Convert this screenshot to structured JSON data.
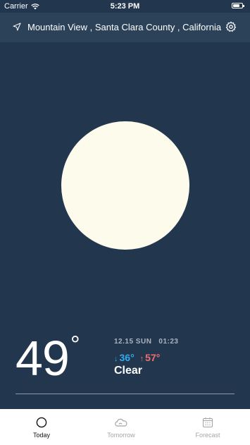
{
  "status_bar": {
    "carrier": "Carrier",
    "time": "5:23 PM"
  },
  "header": {
    "location": "Mountain View , Santa Clara County , California",
    "location_icon": "navigation-arrow-icon",
    "settings_icon": "gear-icon"
  },
  "weather": {
    "condition_icon": "sun-icon",
    "temperature": "49",
    "degree_symbol": "°",
    "date": "12.15 SUN",
    "time": "01:23",
    "low_arrow": "↓",
    "low": "36°",
    "high_arrow": "↑",
    "high": "57°",
    "condition": "Clear"
  },
  "colors": {
    "background": "#22374e",
    "header_background": "#2b4259",
    "sun": "#fdfcec",
    "low_temp": "#34a9ea",
    "high_temp": "#ef6f6f"
  },
  "tabs": [
    {
      "label": "Today",
      "icon": "circle-icon",
      "active": true
    },
    {
      "label": "Tomorrow",
      "icon": "cloud-sun-icon",
      "active": false
    },
    {
      "label": "Forecast",
      "icon": "calendar-icon",
      "active": false
    }
  ]
}
